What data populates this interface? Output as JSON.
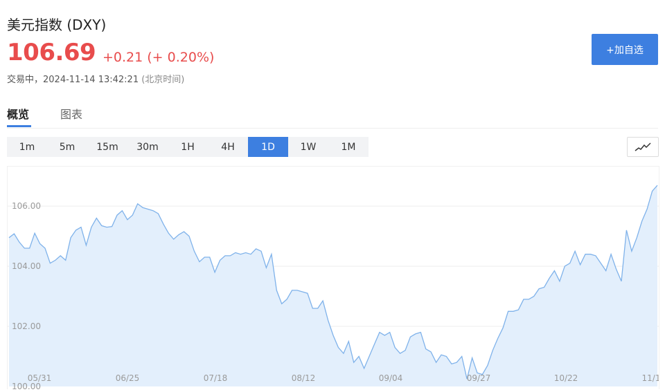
{
  "header": {
    "title": "美元指数 (DXY)",
    "price": "106.69",
    "change": "+0.21 (+ 0.20%)",
    "status_prefix": "交易中，",
    "timestamp": "2024-11-14 13:42:21",
    "timezone": "(北京时间)"
  },
  "actions": {
    "add_watchlist": "+加自选"
  },
  "tabs": [
    {
      "label": "概览",
      "active": true
    },
    {
      "label": "图表",
      "active": false
    }
  ],
  "intervals": [
    {
      "label": "1m"
    },
    {
      "label": "5m"
    },
    {
      "label": "15m"
    },
    {
      "label": "30m"
    },
    {
      "label": "1H"
    },
    {
      "label": "4H"
    },
    {
      "label": "1D",
      "active": true
    },
    {
      "label": "1W"
    },
    {
      "label": "1M"
    }
  ],
  "icons": {
    "chart_type": "line-chart-icon"
  },
  "colors": {
    "up": "#e84c4c",
    "accent": "#3d7fe0",
    "line": "#7fb2ea",
    "fill": "#e3effc"
  },
  "chart_data": {
    "type": "area",
    "title": "",
    "xlabel": "",
    "ylabel": "",
    "ylim": [
      100,
      106.9
    ],
    "y_ticks": [
      "100.00",
      "102.00",
      "104.00",
      "106.00"
    ],
    "x_tick_labels": [
      "05/31",
      "06/25",
      "07/18",
      "08/12",
      "09/04",
      "09/27",
      "10/22",
      "11/1"
    ],
    "grid": true,
    "series": [
      {
        "values": [
          104.95,
          105.08,
          104.8,
          104.6,
          104.6,
          105.1,
          104.75,
          104.6,
          104.1,
          104.2,
          104.35,
          104.2,
          104.95,
          105.2,
          105.3,
          104.7,
          105.3,
          105.6,
          105.35,
          105.3,
          105.32,
          105.7,
          105.85,
          105.55,
          105.7,
          106.08,
          105.95,
          105.9,
          105.85,
          105.75,
          105.4,
          105.1,
          104.9,
          105.05,
          105.15,
          105.0,
          104.5,
          104.15,
          104.3,
          104.3,
          103.8,
          104.2,
          104.35,
          104.35,
          104.45,
          104.4,
          104.45,
          104.4,
          104.58,
          104.5,
          103.95,
          104.4,
          103.2,
          102.75,
          102.9,
          103.2,
          103.2,
          103.15,
          103.1,
          102.6,
          102.6,
          102.85,
          102.2,
          101.7,
          101.3,
          101.1,
          101.5,
          100.8,
          101.0,
          100.6,
          101.0,
          101.4,
          101.8,
          101.7,
          101.8,
          101.3,
          101.1,
          101.2,
          101.65,
          101.75,
          101.8,
          101.25,
          101.15,
          100.8,
          101.05,
          101.0,
          100.75,
          100.8,
          101.0,
          100.25,
          100.95,
          100.45,
          100.4,
          100.7,
          101.2,
          101.6,
          101.95,
          102.5,
          102.5,
          102.55,
          102.9,
          102.9,
          103.0,
          103.25,
          103.3,
          103.6,
          103.85,
          103.5,
          104.0,
          104.1,
          104.5,
          104.05,
          104.4,
          104.4,
          104.35,
          104.1,
          103.85,
          104.4,
          103.9,
          103.5,
          105.2,
          104.5,
          104.95,
          105.5,
          105.9,
          106.5,
          106.69
        ]
      }
    ]
  }
}
